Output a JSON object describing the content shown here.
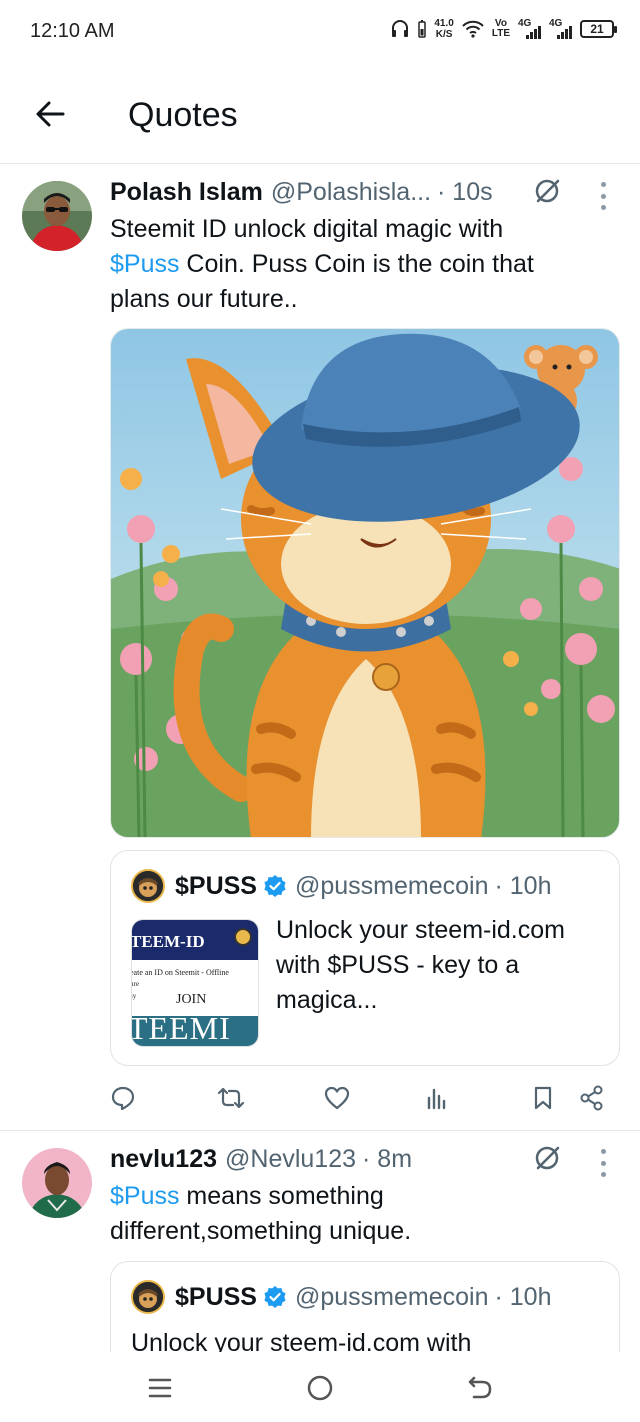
{
  "status_bar": {
    "time": "12:10 AM",
    "net_speed_value": "41.0",
    "net_speed_unit": "K/S",
    "volte_top": "Vo",
    "volte_bottom": "LTE",
    "sim1": "4G",
    "sim2": "4G",
    "battery": "21"
  },
  "header": {
    "title": "Quotes",
    "back_icon": "arrow-left-icon"
  },
  "tweets": [
    {
      "name": "Polash Islam",
      "handle": "@Polashisla...",
      "time": "· 10s",
      "text_cashtag_before": "",
      "text_line1": "Steemit ID unlock digital magic with",
      "cashtag": "$Puss",
      "text_after_cashtag": " Coin. Puss Coin is the coin that",
      "text_line3": "plans our future..",
      "media_alt": "Cartoon orange cat wearing a blue hat in a flower field",
      "quote": {
        "name": "$PUSS",
        "handle": "@pussmemecoin",
        "time": "· 10h",
        "text": "Unlock your steem-id.com with $PUSS - key to a magica...",
        "thumb_title": "TEEM-ID",
        "thumb_line1": "eate an ID on Steemit - Offline",
        "thumb_line2": "ure",
        "thumb_line3": "sy",
        "thumb_join": "JOIN",
        "thumb_big": "TEEMI"
      }
    },
    {
      "name": "nevlu123",
      "handle": "@Nevlu123",
      "time": "· 8m",
      "cashtag": "$Puss",
      "text_after_cashtag": " means something",
      "text_line2": "different,something unique.",
      "quote": {
        "name": "$PUSS",
        "handle": "@pussmemecoin",
        "time": "· 10h",
        "text": "Unlock your steem-id.com with"
      }
    }
  ],
  "colors": {
    "accent": "#1d9bf0",
    "secondary_text": "#536471",
    "primary_text": "#0f1419"
  },
  "actions": [
    "reply-icon",
    "retweet-icon",
    "like-icon",
    "views-icon",
    "bookmark-icon",
    "share-icon"
  ],
  "nav": [
    "recents-icon",
    "home-icon",
    "back-icon"
  ]
}
